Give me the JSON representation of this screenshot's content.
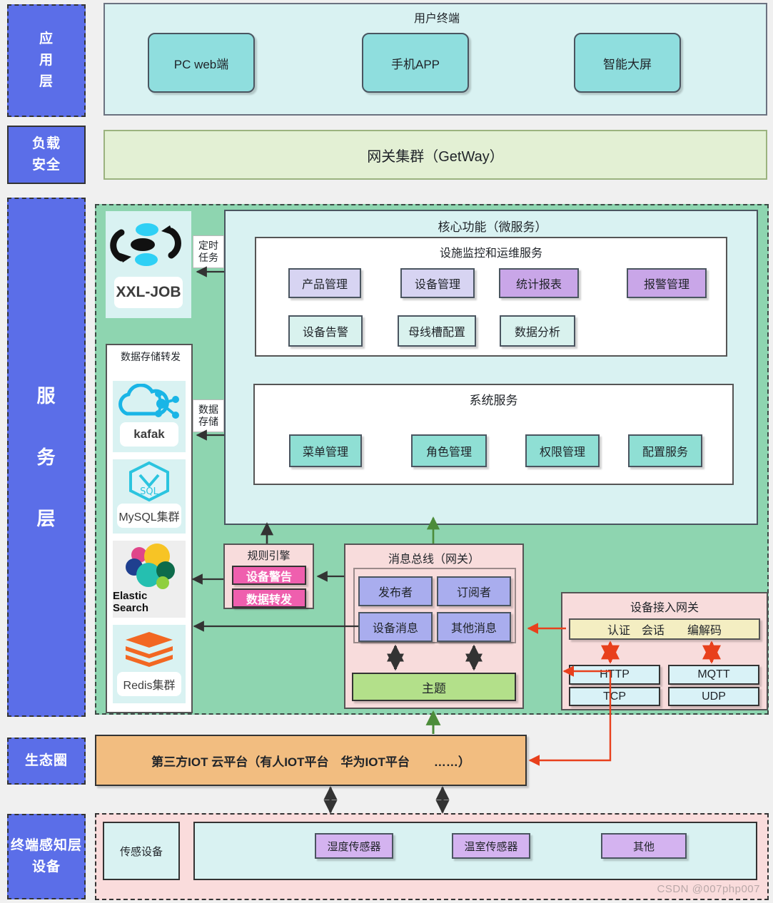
{
  "layers": [
    {
      "id": "app",
      "label": "应用\n层",
      "label_lines": [
        "应",
        "用",
        "层"
      ]
    },
    {
      "id": "lb",
      "label_lines": [
        "负载",
        "安全"
      ]
    },
    {
      "id": "svc",
      "label_lines": [
        "服",
        "务",
        "层"
      ]
    },
    {
      "id": "eco",
      "label_lines": [
        "生态圈"
      ]
    },
    {
      "id": "term",
      "label_lines": [
        "终端感知层",
        "设备"
      ]
    }
  ],
  "app_layer": {
    "title": "用户终端",
    "nodes": [
      {
        "label": "PC web端"
      },
      {
        "label": "手机APP"
      },
      {
        "label": "智能大屏"
      }
    ]
  },
  "gateway_layer": {
    "label": "网关集群（GetWay）"
  },
  "service_layer": {
    "scheduler": {
      "name": "XXL-JOB",
      "icon": "xxl-job-logo"
    },
    "storage": {
      "title": "数据存储转发",
      "items": [
        {
          "name": "kafak",
          "icon": "kafka-logo"
        },
        {
          "name": "MySQL集群",
          "icon": "mysql-logo"
        },
        {
          "name": "Elastic Search",
          "icon": "elasticsearch-logo"
        },
        {
          "name": "Redis集群",
          "icon": "redis-logo"
        }
      ]
    },
    "edge_labels": [
      {
        "lines": [
          "定时",
          "任务"
        ]
      },
      {
        "lines": [
          "数据",
          "存储"
        ]
      }
    ],
    "core": {
      "title": "核心功能（微服务）",
      "groups": [
        {
          "title": "设施监控和运维服务",
          "row1": [
            {
              "label": "产品管理",
              "style": "lav"
            },
            {
              "label": "设备管理",
              "style": "lav"
            },
            {
              "label": "统计报表",
              "style": "purple"
            },
            {
              "label": "报警管理",
              "style": "purple"
            }
          ],
          "row2": [
            {
              "label": "设备告警",
              "style": "mint"
            },
            {
              "label": "母线槽配置",
              "style": "mint"
            },
            {
              "label": "数据分析",
              "style": "mint"
            }
          ]
        },
        {
          "title": "系统服务",
          "row1": [
            {
              "label": "菜单管理",
              "style": "teal"
            },
            {
              "label": "角色管理",
              "style": "teal"
            },
            {
              "label": "权限管理",
              "style": "teal"
            },
            {
              "label": "配置服务",
              "style": "teal"
            }
          ],
          "row2": []
        }
      ]
    },
    "rule_engine": {
      "title": "规则引擎",
      "items": [
        {
          "label": "设备警告"
        },
        {
          "label": "数据转发"
        }
      ]
    },
    "message_bus": {
      "title": "消息总线（网关）",
      "items": [
        {
          "label": "发布者"
        },
        {
          "label": "订阅者"
        },
        {
          "label": "设备消息"
        },
        {
          "label": "其他消息"
        }
      ],
      "topic": "主题"
    },
    "device_gateway": {
      "title": "设备接入网关",
      "capabilities": "认证　会话　　编解码",
      "protocols": [
        {
          "label": "HTTP"
        },
        {
          "label": "MQTT"
        },
        {
          "label": "TCP"
        },
        {
          "label": "UDP"
        }
      ]
    }
  },
  "eco_layer": {
    "label": "第三方IOT 云平台（有人IOT平台　华为IOT平台　　……）"
  },
  "terminal_layer": {
    "sensor_group_label": "传感设备",
    "sensors": [
      {
        "label": "湿度传感器"
      },
      {
        "label": "温室传感器"
      },
      {
        "label": "其他"
      }
    ]
  },
  "watermark": "CSDN @007php007",
  "colors": {
    "layer_label": "#5b6ee8",
    "service_green": "#8ed5b0",
    "core_cyan": "#d9f2f2",
    "pink": "#f8dcdc",
    "orange": "#f2bd80",
    "topic_green": "#b3e08a",
    "magenta": "#ef5fae",
    "red_arrow": "#e8401c",
    "green_arrow": "#4c8c3a"
  }
}
